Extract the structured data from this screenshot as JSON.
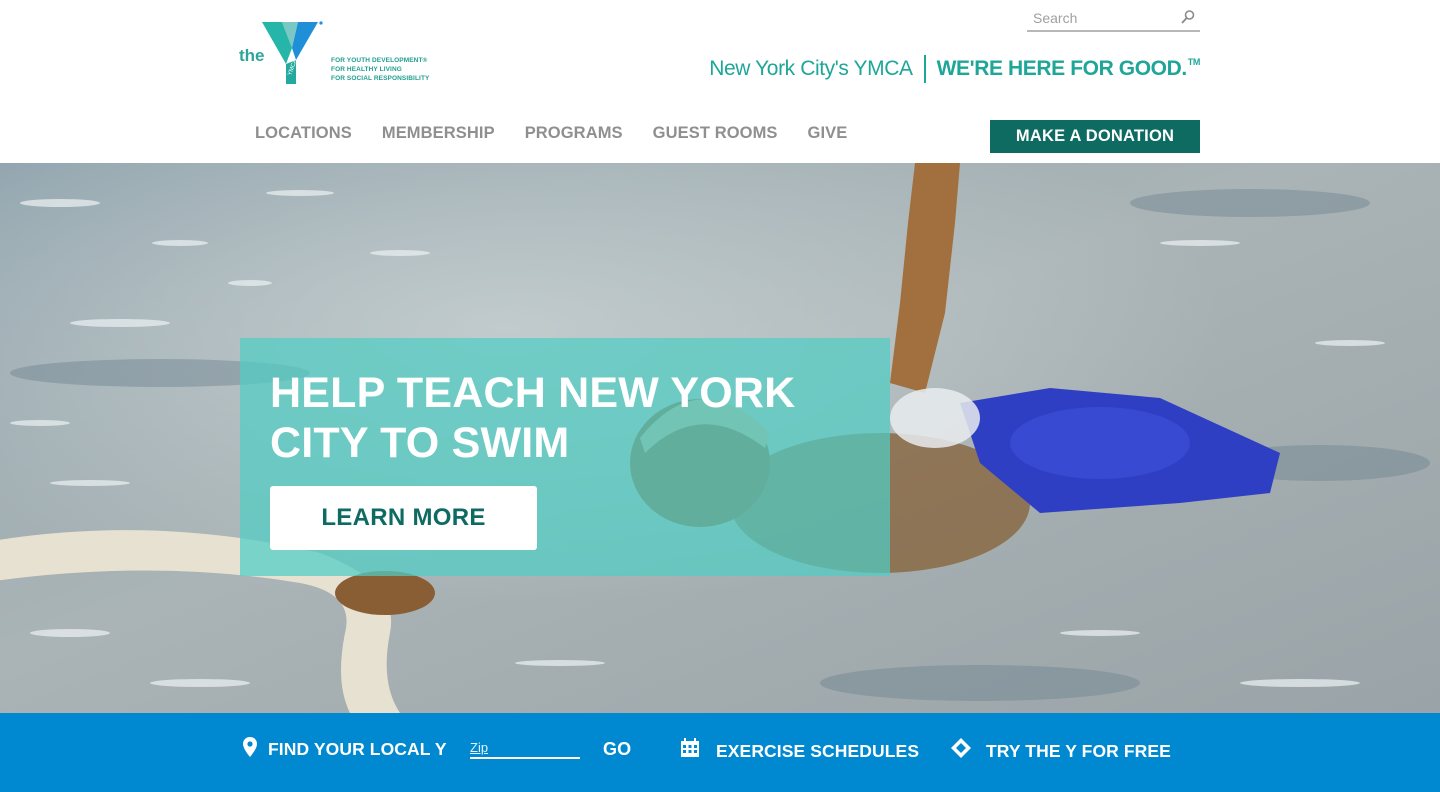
{
  "logo": {
    "the": "the",
    "tagline": [
      "FOR YOUTH DEVELOPMENT®",
      "FOR HEALTHY LIVING",
      "FOR SOCIAL RESPONSIBILITY"
    ]
  },
  "search": {
    "placeholder": "Search",
    "icon": "search-icon"
  },
  "brand": {
    "name": "New York City's YMCA",
    "slogan": "WE'RE HERE FOR GOOD.",
    "slogan_mark": "TM"
  },
  "nav": {
    "items": [
      "LOCATIONS",
      "MEMBERSHIP",
      "PROGRAMS",
      "GUEST ROOMS",
      "GIVE"
    ],
    "donate_label": "MAKE A DONATION"
  },
  "hero": {
    "title": "HELP TEACH NEW YORK CITY TO SWIM",
    "button_label": "LEARN MORE"
  },
  "bottom_bar": {
    "find_label": "FIND YOUR LOCAL Y",
    "zip_placeholder": "Zip",
    "go_label": "GO",
    "exercise_label": "EXERCISE SCHEDULES",
    "try_label": "TRY THE Y FOR FREE"
  },
  "colors": {
    "brand_teal": "#1ea698",
    "dark_teal": "#0e6b62",
    "bar_blue": "#0089d0",
    "nav_gray": "#8f8f8f"
  }
}
